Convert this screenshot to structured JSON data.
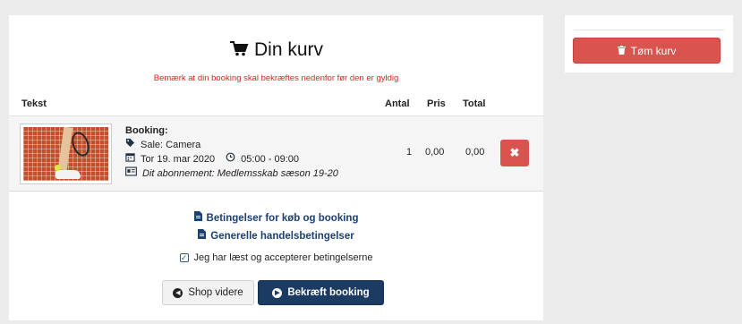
{
  "cart": {
    "title": "Din kurv",
    "warning": "Bemærk at din booking skal bekræftes nedenfor før den er gyldig",
    "columns": {
      "text": "Tekst",
      "qty": "Antal",
      "price": "Pris",
      "total": "Total"
    },
    "items": [
      {
        "heading": "Booking:",
        "hall": "Sale: Camera",
        "date": "Tor 19. mar 2020",
        "time": "05:00 - 09:00",
        "subscription": "Dit abonnement: Medlemsskab sæson 19-20",
        "qty": "1",
        "price": "0,00",
        "total": "0,00",
        "remove_label": "✖"
      }
    ],
    "links": {
      "terms_booking": "Betingelser for køb og booking",
      "terms_general": "Generelle handelsbetingelser"
    },
    "accept_label": "Jeg har læst og accepterer betingelserne",
    "shop_more_label": "Shop videre",
    "confirm_label": "Bekræft booking"
  },
  "sidebar": {
    "empty_cart_label": "Tøm kurv"
  },
  "icons": {
    "cart": "cart-icon",
    "trash": "trash-icon",
    "tag": "tag-icon",
    "calendar": "calendar-icon",
    "clock": "clock-icon",
    "card": "id-card-icon",
    "document": "document-icon",
    "check": "check-icon",
    "chevron_left": "chevron-left-circle-icon",
    "chevron_right": "chevron-right-circle-icon"
  },
  "colors": {
    "danger": "#d9534f",
    "primary": "#1b3b63",
    "link": "#1c3f74",
    "warning_text": "#e0201e"
  }
}
